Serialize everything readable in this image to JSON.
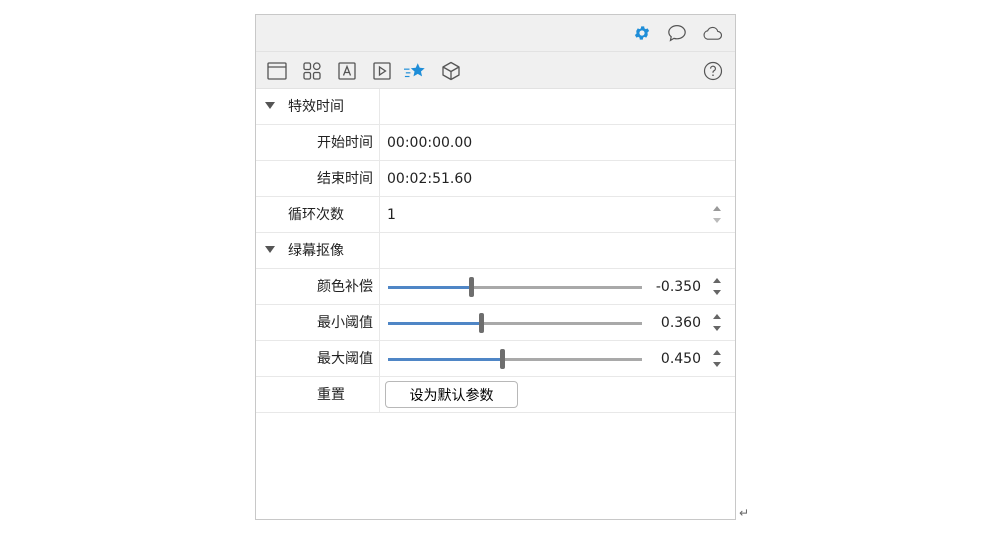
{
  "colors": {
    "accent": "#1f8ed8",
    "slider_fill": "#4f86c6",
    "slider_track": "#a9a9a9"
  },
  "topbar": {
    "icons": [
      "gear-icon",
      "chat-bubble-icon",
      "cloud-icon"
    ]
  },
  "toolbar": {
    "icons": [
      "window-icon",
      "grid-icon",
      "text-icon",
      "play-icon",
      "star-effect-icon",
      "cube-icon",
      "help-icon"
    ]
  },
  "sections": {
    "timing": {
      "title": "特效时间",
      "start_label": "开始时间",
      "start_value": "00:00:00.00",
      "end_label": "结束时间",
      "end_value": "00:02:51.60"
    },
    "loop": {
      "label": "循环次数",
      "value": "1"
    },
    "chroma": {
      "title": "绿幕抠像",
      "sliders": [
        {
          "label": "颜色补偿",
          "value_text": "-0.350",
          "fraction": 0.327
        },
        {
          "label": "最小阈值",
          "value_text": "0.360",
          "fraction": 0.365
        },
        {
          "label": "最大阈值",
          "value_text": "0.450",
          "fraction": 0.45
        }
      ]
    },
    "reset": {
      "label": "重置",
      "button_label": "设为默认参数"
    }
  },
  "return_symbol": "↵"
}
